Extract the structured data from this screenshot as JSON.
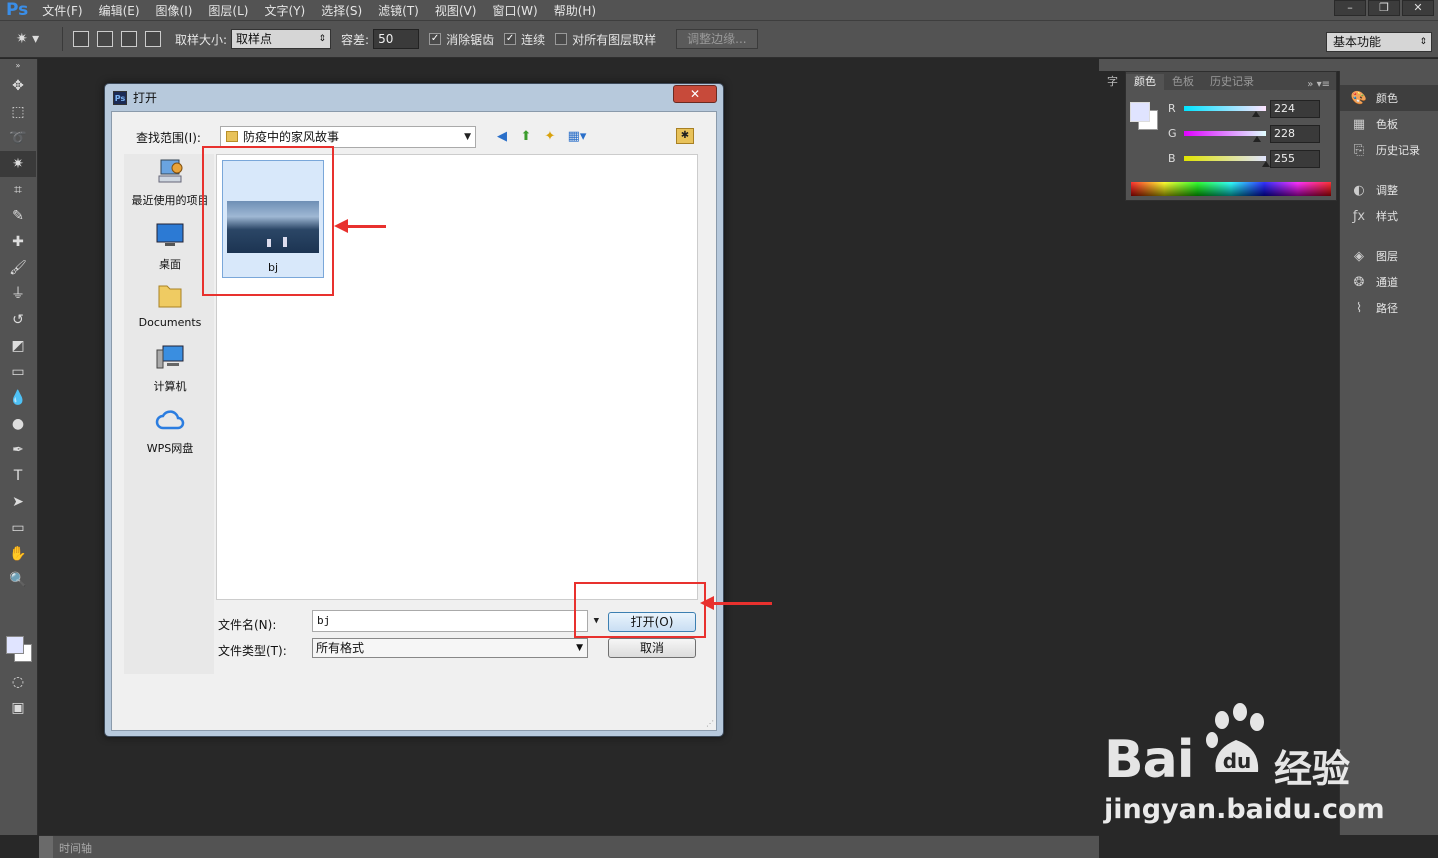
{
  "app": {
    "logo": "Ps",
    "menu": [
      "文件(F)",
      "编辑(E)",
      "图像(I)",
      "图层(L)",
      "文字(Y)",
      "选择(S)",
      "滤镜(T)",
      "视图(V)",
      "窗口(W)",
      "帮助(H)"
    ],
    "window_controls": [
      "–",
      "❐",
      "✕"
    ]
  },
  "options_bar": {
    "sample_size_label": "取样大小:",
    "sample_size_value": "取样点",
    "tolerance_label": "容差:",
    "tolerance_value": "50",
    "antialias_label": "消除锯齿",
    "antialias_checked": true,
    "contiguous_label": "连续",
    "contiguous_checked": true,
    "all_layers_label": "对所有图层取样",
    "all_layers_checked": false,
    "refine_edge_label": "调整边缘...",
    "workspace": "基本功能"
  },
  "timeline": {
    "label": "时间轴"
  },
  "color_panel": {
    "collapsed_tab": "字",
    "tabs": [
      "颜色",
      "色板",
      "历史记录"
    ],
    "active_tab": "颜色",
    "colors": {
      "fg": "#e0e4ff",
      "bg": "#ffffff"
    },
    "channels": [
      {
        "letter": "R",
        "value": "224",
        "fraction": 0.878
      },
      {
        "letter": "G",
        "value": "228",
        "fraction": 0.894
      },
      {
        "letter": "B",
        "value": "255",
        "fraction": 1.0
      }
    ]
  },
  "dock": {
    "items": [
      {
        "label": "颜色",
        "icon": "palette-icon",
        "active": true
      },
      {
        "label": "色板",
        "icon": "swatches-grid-icon"
      },
      {
        "label": "历史记录",
        "icon": "history-icon"
      },
      {
        "label": "调整",
        "icon": "adjustments-icon"
      },
      {
        "label": "样式",
        "icon": "styles-fx-icon"
      },
      {
        "label": "图层",
        "icon": "layers-icon"
      },
      {
        "label": "通道",
        "icon": "channels-icon"
      },
      {
        "label": "路径",
        "icon": "paths-icon"
      }
    ]
  },
  "dialog": {
    "title": "打开",
    "close": "✕",
    "look_in_label": "查找范围(I):",
    "look_in_value": "防疫中的家风故事",
    "places": [
      "最近使用的项目",
      "桌面",
      "Documents",
      "计算机",
      "WPS网盘"
    ],
    "files": [
      {
        "name": "bj",
        "selected": true
      }
    ],
    "filename_label": "文件名(N):",
    "filename_value": "bj",
    "filetype_label": "文件类型(T):",
    "filetype_value": "所有格式",
    "open_button": "打开(O)",
    "cancel_button": "取消"
  },
  "watermark": {
    "logo_text": "Bai",
    "logo_text_2": "du",
    "cn": "经验",
    "url": "jingyan.baidu.com"
  },
  "accent_colors": {
    "annotation_red": "#e8312e",
    "ps_blue": "#3a8ee8"
  }
}
